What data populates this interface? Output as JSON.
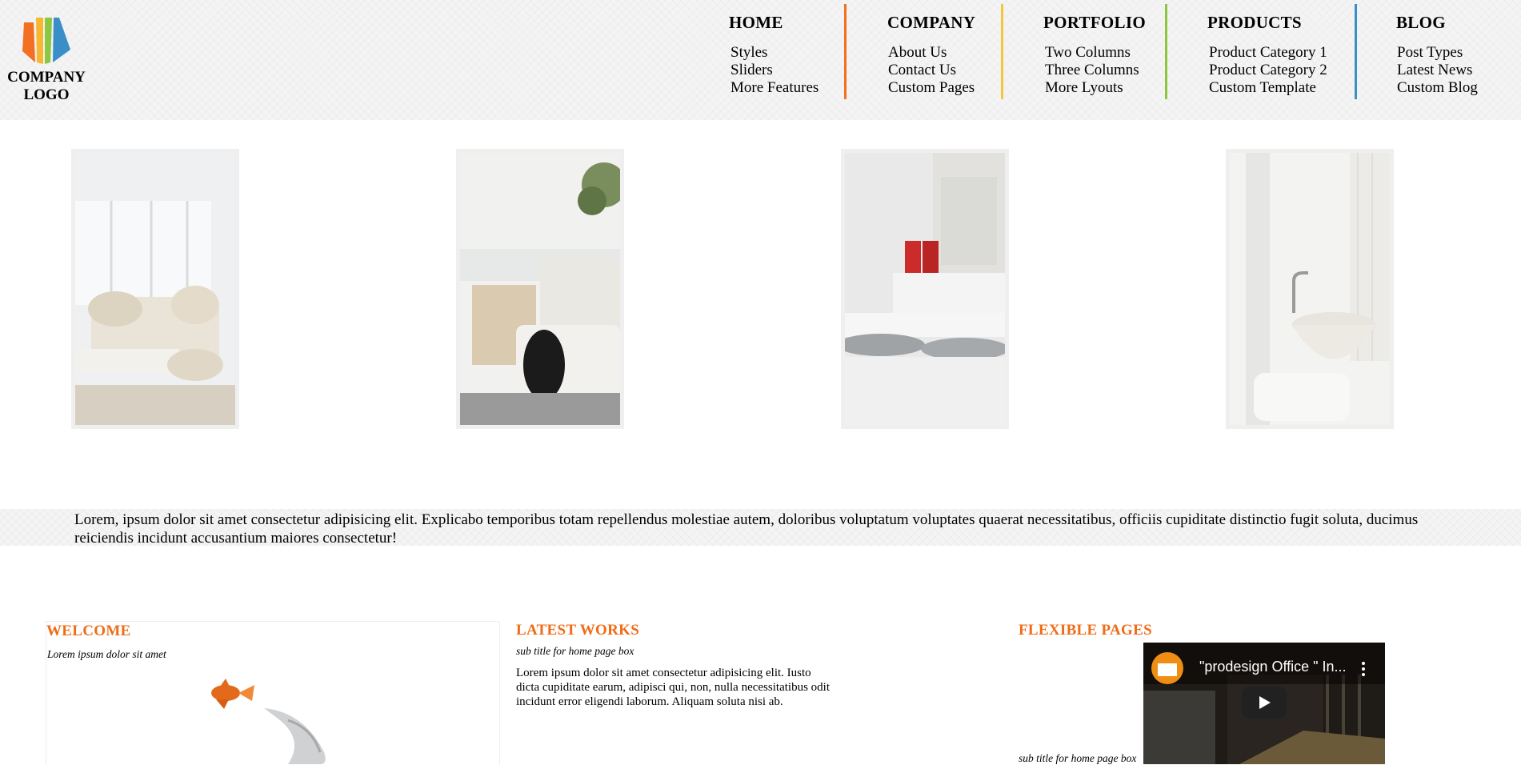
{
  "logo": {
    "line1": "COMPANY",
    "line2": "LOGO",
    "colors": [
      "#f36f21",
      "#f7b731",
      "#8dc63f",
      "#3a8fc9"
    ]
  },
  "nav": {
    "menus": [
      {
        "title": "HOME",
        "items": [
          "Styles",
          "Sliders",
          "More Features"
        ],
        "divider_color": "#f36f21"
      },
      {
        "title": "COMPANY",
        "items": [
          "About Us",
          "Contact Us",
          "Custom Pages"
        ],
        "divider_color": "#f7c53c"
      },
      {
        "title": "PORTFOLIO",
        "items": [
          "Two Columns",
          "Three Columns",
          "More Lyouts"
        ],
        "divider_color": "#8dc63f"
      },
      {
        "title": "PRODUCTS",
        "items": [
          "Product Category 1",
          "Product Category 2",
          "Custom Template"
        ],
        "divider_color": "#3a8fc9"
      },
      {
        "title": "BLOG",
        "items": [
          "Post Types",
          "Latest News",
          "Custom Blog"
        ]
      }
    ]
  },
  "gallery": {
    "images": [
      {
        "name": "living-room-image"
      },
      {
        "name": "lounge-chair-image"
      },
      {
        "name": "kitchen-image"
      },
      {
        "name": "bathroom-image"
      }
    ]
  },
  "intro": {
    "text": "Lorem, ipsum dolor sit amet consectetur adipisicing elit. Explicabo temporibus totam repellendus molestiae autem, doloribus voluptatum voluptates quaerat necessitatibus, officiis cupiditate distinctio fugit soluta, ducimus reiciendis incidunt accusantium maiores consectetur!"
  },
  "boxes": {
    "welcome": {
      "title": "WELCOME",
      "subtitle": "Lorem ipsum dolor sit amet"
    },
    "latest": {
      "title": "LATEST WORKS",
      "subtitle": "sub title for home page box",
      "body": "Lorem ipsum dolor sit amet consectetur adipisicing elit. Iusto dicta cupiditate earum, adipisci qui, non, nulla necessitatibus odit incidunt error eligendi laborum. Aliquam soluta nisi ab."
    },
    "flexible": {
      "title": "FLEXIBLE PAGES",
      "subtitle": "sub title for home page box",
      "video_title": "\"prodesign Office \" In..."
    }
  },
  "colors": {
    "accent": "#ef6b16"
  }
}
